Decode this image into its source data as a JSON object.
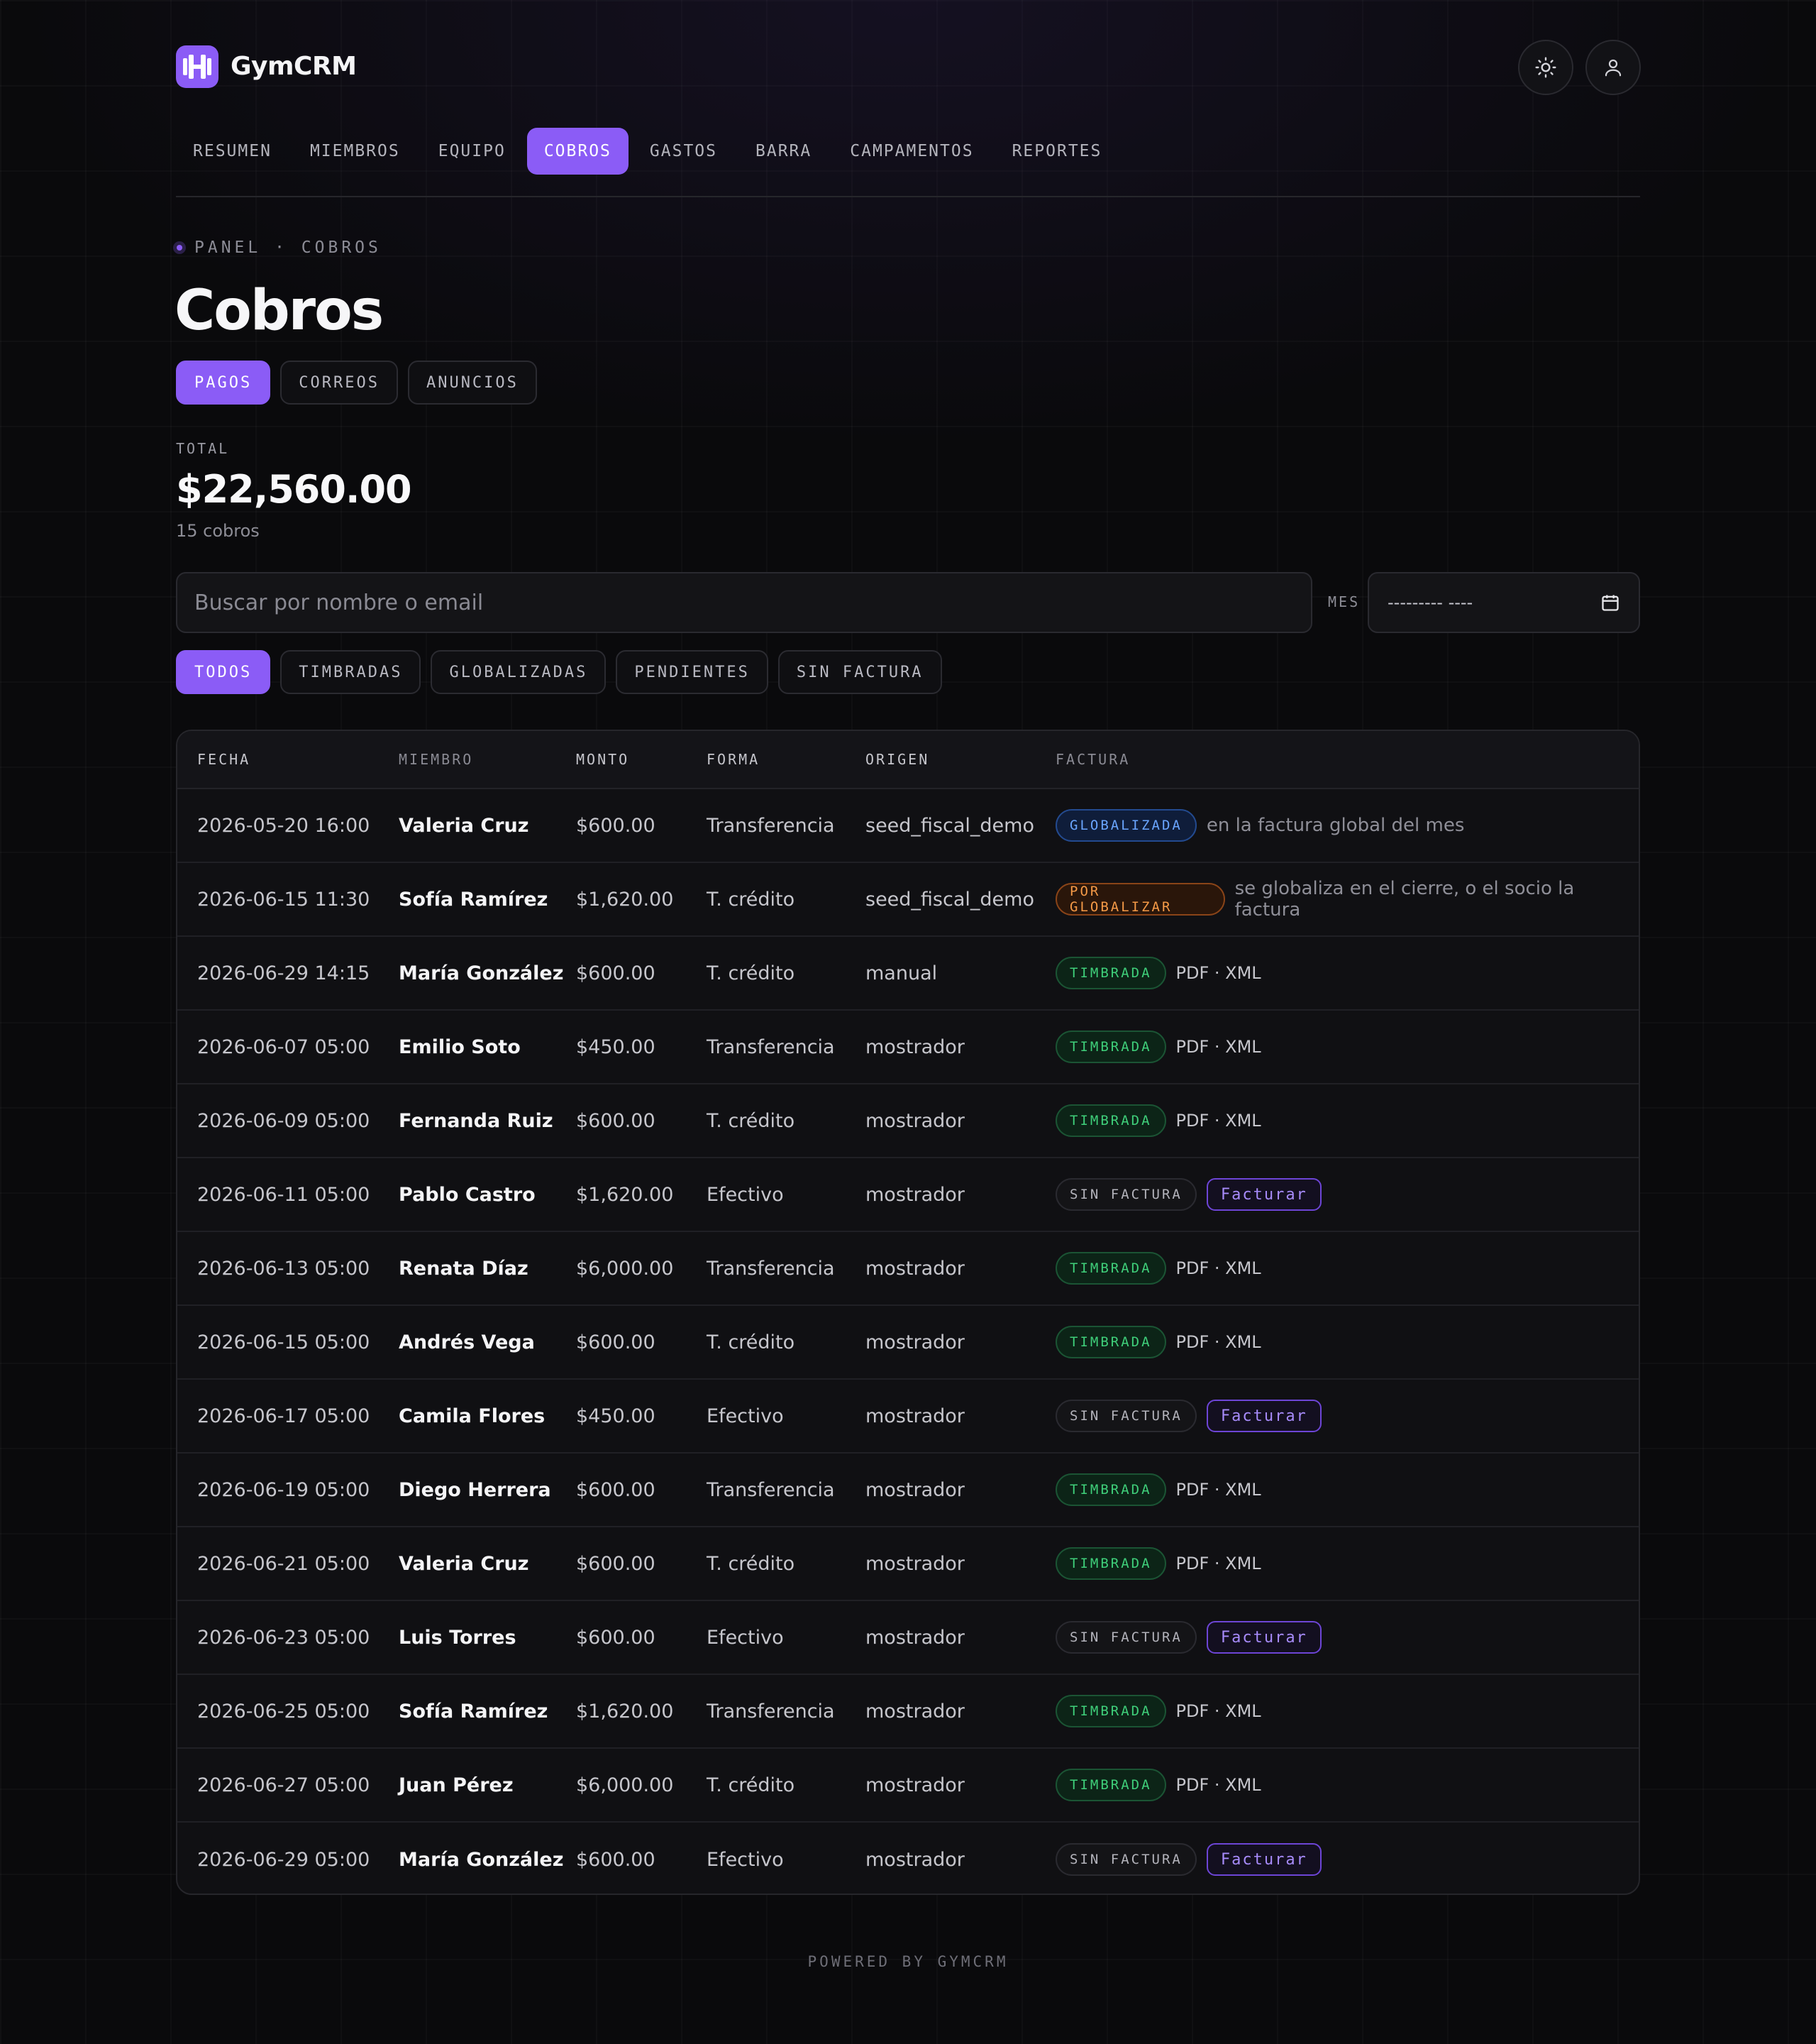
{
  "app": {
    "name": "GymCRM"
  },
  "nav": {
    "items": [
      "RESUMEN",
      "MIEMBROS",
      "EQUIPO",
      "COBROS",
      "GASTOS",
      "BARRA",
      "CAMPAMENTOS",
      "REPORTES"
    ],
    "active": "COBROS"
  },
  "breadcrumb": "PANEL · COBROS",
  "page": {
    "title": "Cobros"
  },
  "section_tabs": {
    "items": [
      "PAGOS",
      "CORREOS",
      "ANUNCIOS"
    ],
    "active": "PAGOS"
  },
  "summary": {
    "label": "TOTAL",
    "amount": "$22,560.00",
    "count": "15 cobros"
  },
  "search": {
    "placeholder": "Buscar por nombre o email"
  },
  "month": {
    "label": "MES",
    "value": "--------- ----"
  },
  "filters": {
    "items": [
      "TODOS",
      "TIMBRADAS",
      "GLOBALIZADAS",
      "PENDIENTES",
      "SIN FACTURA"
    ],
    "active": "TODOS"
  },
  "table": {
    "columns": [
      "FECHA",
      "MIEMBRO",
      "MONTO",
      "FORMA",
      "ORIGEN",
      "FACTURA"
    ],
    "rows": [
      {
        "fecha": "2026-05-20 16:00",
        "miembro": "Valeria Cruz",
        "monto": "$600.00",
        "forma": "Transferencia",
        "origen": "seed_fiscal_demo",
        "status": "GLOBALIZADA",
        "note": "en la factura global del mes"
      },
      {
        "fecha": "2026-06-15 11:30",
        "miembro": "Sofía Ramírez",
        "monto": "$1,620.00",
        "forma": "T. crédito",
        "origen": "seed_fiscal_demo",
        "status": "POR GLOBALIZAR",
        "note": "se globaliza en el cierre, o el socio la factura"
      },
      {
        "fecha": "2026-06-29 14:15",
        "miembro": "María González",
        "monto": "$600.00",
        "forma": "T. crédito",
        "origen": "manual",
        "status": "TIMBRADA",
        "note": "PDF · XML"
      },
      {
        "fecha": "2026-06-07 05:00",
        "miembro": "Emilio Soto",
        "monto": "$450.00",
        "forma": "Transferencia",
        "origen": "mostrador",
        "status": "TIMBRADA",
        "note": "PDF · XML"
      },
      {
        "fecha": "2026-06-09 05:00",
        "miembro": "Fernanda Ruiz",
        "monto": "$600.00",
        "forma": "T. crédito",
        "origen": "mostrador",
        "status": "TIMBRADA",
        "note": "PDF · XML"
      },
      {
        "fecha": "2026-06-11 05:00",
        "miembro": "Pablo Castro",
        "monto": "$1,620.00",
        "forma": "Efectivo",
        "origen": "mostrador",
        "status": "SIN FACTURA",
        "action": "Facturar"
      },
      {
        "fecha": "2026-06-13 05:00",
        "miembro": "Renata Díaz",
        "monto": "$6,000.00",
        "forma": "Transferencia",
        "origen": "mostrador",
        "status": "TIMBRADA",
        "note": "PDF · XML"
      },
      {
        "fecha": "2026-06-15 05:00",
        "miembro": "Andrés Vega",
        "monto": "$600.00",
        "forma": "T. crédito",
        "origen": "mostrador",
        "status": "TIMBRADA",
        "note": "PDF · XML"
      },
      {
        "fecha": "2026-06-17 05:00",
        "miembro": "Camila Flores",
        "monto": "$450.00",
        "forma": "Efectivo",
        "origen": "mostrador",
        "status": "SIN FACTURA",
        "action": "Facturar"
      },
      {
        "fecha": "2026-06-19 05:00",
        "miembro": "Diego Herrera",
        "monto": "$600.00",
        "forma": "Transferencia",
        "origen": "mostrador",
        "status": "TIMBRADA",
        "note": "PDF · XML"
      },
      {
        "fecha": "2026-06-21 05:00",
        "miembro": "Valeria Cruz",
        "monto": "$600.00",
        "forma": "T. crédito",
        "origen": "mostrador",
        "status": "TIMBRADA",
        "note": "PDF · XML"
      },
      {
        "fecha": "2026-06-23 05:00",
        "miembro": "Luis Torres",
        "monto": "$600.00",
        "forma": "Efectivo",
        "origen": "mostrador",
        "status": "SIN FACTURA",
        "action": "Facturar"
      },
      {
        "fecha": "2026-06-25 05:00",
        "miembro": "Sofía Ramírez",
        "monto": "$1,620.00",
        "forma": "Transferencia",
        "origen": "mostrador",
        "status": "TIMBRADA",
        "note": "PDF · XML"
      },
      {
        "fecha": "2026-06-27 05:00",
        "miembro": "Juan Pérez",
        "monto": "$6,000.00",
        "forma": "T. crédito",
        "origen": "mostrador",
        "status": "TIMBRADA",
        "note": "PDF · XML"
      },
      {
        "fecha": "2026-06-29 05:00",
        "miembro": "María González",
        "monto": "$600.00",
        "forma": "Efectivo",
        "origen": "mostrador",
        "status": "SIN FACTURA",
        "action": "Facturar"
      }
    ]
  },
  "footer": "POWERED BY GYMCRM",
  "icons": {
    "logo": "dumbbell-icon",
    "theme": "sun-icon",
    "user": "user-icon",
    "calendar": "calendar-icon"
  },
  "colors": {
    "accent": "#8b5cf6",
    "background": "#0a0a0c",
    "globalizada": "#6aa5ff",
    "por_globalizar": "#f59a47",
    "timbrada": "#3fcf7a"
  }
}
